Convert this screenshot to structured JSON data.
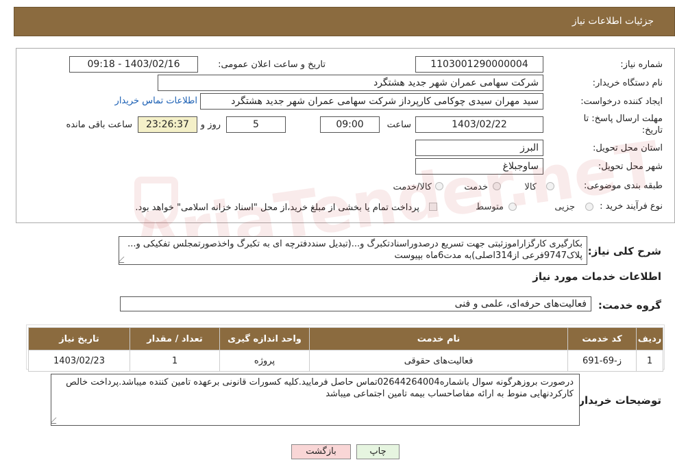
{
  "header": {
    "title": "جزئیات اطلاعات نیاز"
  },
  "form": {
    "need_number_label": "شماره نیاز:",
    "need_number": "1103001290000004",
    "announce_label": "تاریخ و ساعت اعلان عمومی:",
    "announce_value": "1403/02/16 - 09:18",
    "buyer_org_label": "نام دستگاه خریدار:",
    "buyer_org": "شرکت سهامی عمران شهر جدید هشتگرد",
    "creator_label": "ایجاد کننده درخواست:",
    "creator": "سید مهران سیدی چوکامی کارپرداز شرکت سهامی عمران شهر جدید هشتگرد",
    "contact_link": "اطلاعات تماس خریدار",
    "deadline_label_1": "مهلت ارسال پاسخ: تا",
    "deadline_label_2": "تاریخ:",
    "deadline_date": "1403/02/22",
    "time_label": "ساعت",
    "deadline_time": "09:00",
    "days_value": "5",
    "days_label": "روز و",
    "remaining_time": "23:26:37",
    "remaining_label": "ساعت باقی مانده",
    "province_label": "استان محل تحویل:",
    "province": "البرز",
    "city_label": "شهر محل تحویل:",
    "city": "ساوجبلاغ",
    "category_label": "طبقه بندی موضوعی:",
    "category_options": [
      "کالا",
      "خدمت",
      "کالا/خدمت"
    ],
    "process_label": "نوع فرآیند خرید :",
    "process_options": [
      "جزیی",
      "متوسط"
    ],
    "payment_note": "پرداخت تمام یا بخشی از مبلغ خرید،از محل \"اسناد خزانه اسلامی\" خواهد بود."
  },
  "description": {
    "label": "شرح کلی نیاز:",
    "text": "بکارگیری کارگزاراموزثبتی جهت تسریع درصدوراسنادتکبرگ و...(تبدیل سنددفترچه ای به تکبرگ واخذصورتمجلس تفکیکی و... پلاک9747فرعی از314اصلی)به مدت6ماه بپیوست"
  },
  "services": {
    "section_title": "اطلاعات خدمات مورد نیاز",
    "group_label": "گروه خدمت:",
    "group_value": "فعالیت‌های حرفه‌ای، علمی و فنی",
    "columns": [
      "ردیف",
      "کد خدمت",
      "نام خدمت",
      "واحد اندازه گیری",
      "تعداد / مقدار",
      "تاریخ نیاز"
    ],
    "rows": [
      [
        "1",
        "ز-69-691",
        "فعالیت‌های حقوقی",
        "پروژه",
        "1",
        "1403/02/23"
      ]
    ]
  },
  "buyer_notes": {
    "label": "توضیحات خریدار:",
    "text": "درصورت بروزهرگونه سوال باشماره02644264004تماس حاصل فرمایید.کلیه کسورات قانونی برعهده تامین کننده میباشد.پرداخت خالص کارکردنهایی منوط به ارائه مفاصاحساب بیمه تامین اجتماعی میباشد"
  },
  "buttons": {
    "print": "چاپ",
    "back": "بازگشت"
  },
  "watermark": "AriaTender.neT",
  "colors": {
    "header_bg": "#8b6b3f",
    "link": "#1a5fb4",
    "back_button": "#f9d6d6",
    "print_button": "#e6f5e0"
  }
}
